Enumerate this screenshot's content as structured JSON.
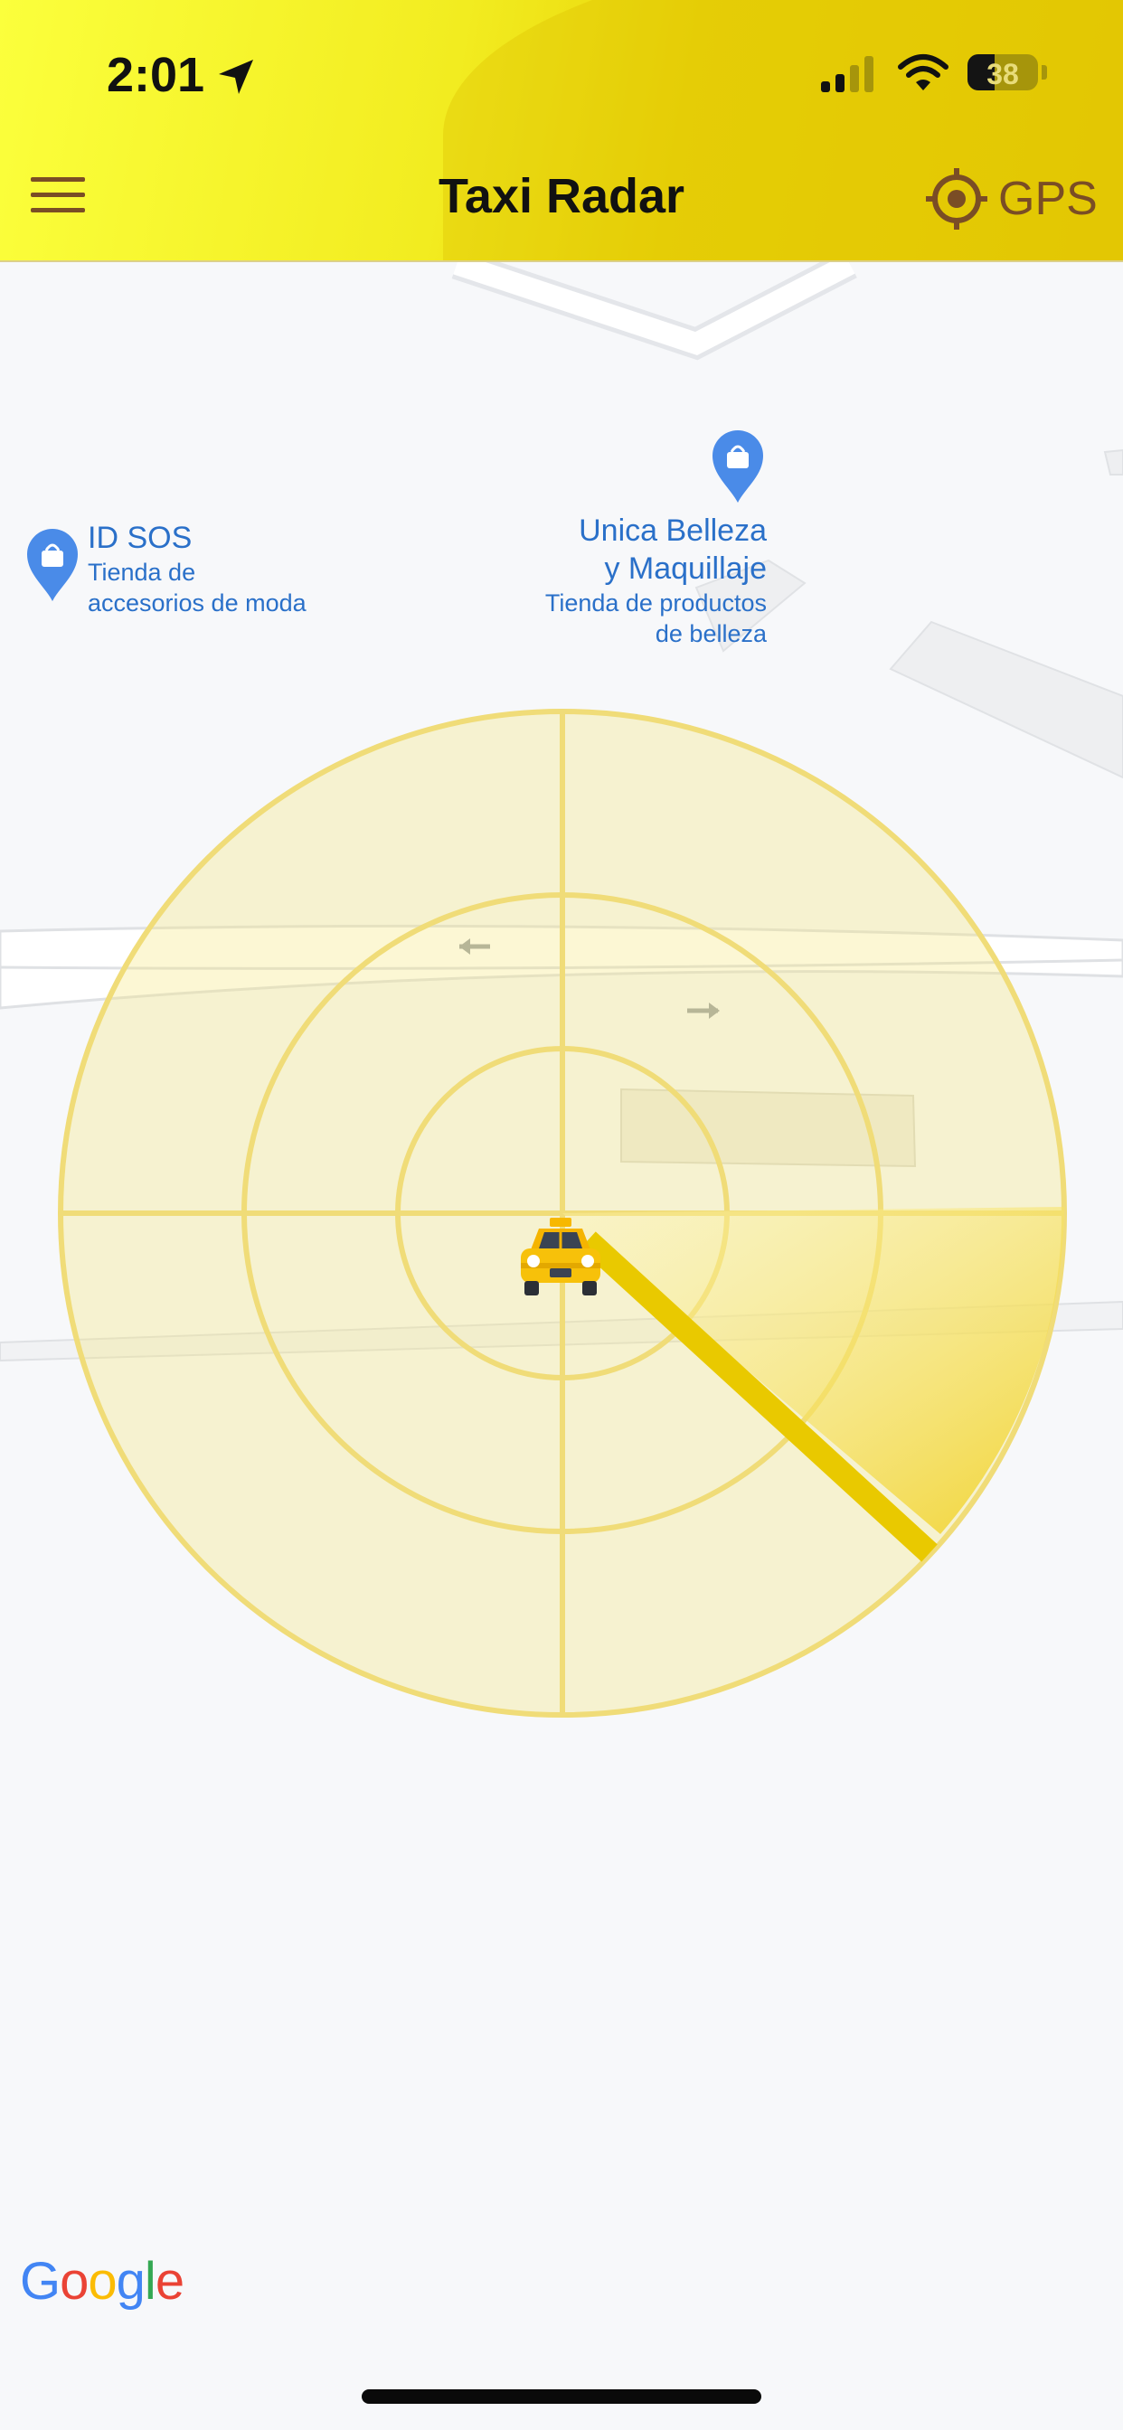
{
  "status_bar": {
    "time": "2:01",
    "battery": "38",
    "battery_level": 0.38,
    "signal_bars_active": 2,
    "signal_bars_total": 4
  },
  "header": {
    "title": "Taxi Radar",
    "gps_label": "GPS"
  },
  "map": {
    "pois": [
      {
        "name": "ID SOS",
        "description_line1": "Tienda de",
        "description_line2": "accesorios de moda"
      },
      {
        "name_line1": "Unica Belleza",
        "name_line2": "y Maquillaje",
        "description_line1": "Tienda de productos",
        "description_line2": "de belleza"
      }
    ],
    "attribution": "Google"
  },
  "radar": {
    "taxi_icon": "taxi-icon",
    "sweep_icon": "radar-sweep"
  },
  "colors": {
    "header_yellow": "#f2ec20",
    "accent_brown": "#7a4d25",
    "radar_yellow": "#f3e67a",
    "poi_blue": "#2a70c9"
  }
}
